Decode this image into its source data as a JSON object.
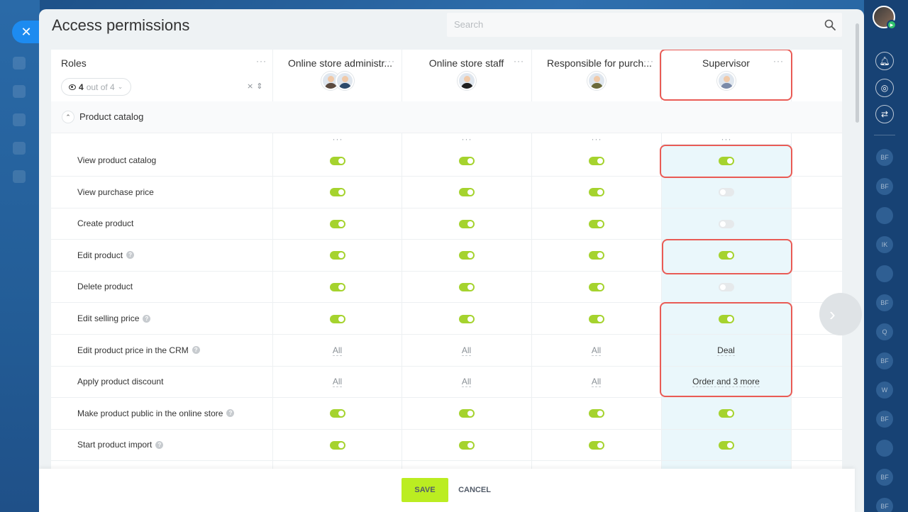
{
  "page": {
    "title": "Access permissions"
  },
  "search": {
    "placeholder": "Search",
    "value": ""
  },
  "roles_header": {
    "label": "Roles",
    "filter_visible": "4",
    "filter_suffix": "out of 4"
  },
  "roles": [
    {
      "name": "Online store administr...",
      "avatars": [
        "#5b4a3f",
        "#2d4a6b"
      ]
    },
    {
      "name": "Online store staff",
      "avatars": [
        "#1f1f1f"
      ]
    },
    {
      "name": "Responsible for purch...",
      "avatars": [
        "#6b6a3a"
      ]
    },
    {
      "name": "Supervisor",
      "avatars": [
        "#7a8aa8"
      ]
    }
  ],
  "section": {
    "title": "Product catalog"
  },
  "permissions": [
    {
      "label": "View product catalog",
      "help": false,
      "values": [
        "on",
        "on",
        "on",
        "on"
      ]
    },
    {
      "label": "View purchase price",
      "help": false,
      "values": [
        "on",
        "on",
        "on",
        "off"
      ]
    },
    {
      "label": "Create product",
      "help": false,
      "values": [
        "on",
        "on",
        "on",
        "off"
      ]
    },
    {
      "label": "Edit product",
      "help": true,
      "values": [
        "on",
        "on",
        "on",
        "on"
      ]
    },
    {
      "label": "Delete product",
      "help": false,
      "values": [
        "on",
        "on",
        "on",
        "off"
      ]
    },
    {
      "label": "Edit selling price",
      "help": true,
      "values": [
        "on",
        "on",
        "on",
        "on"
      ]
    },
    {
      "label": "Edit product price in the CRM",
      "help": true,
      "values": [
        "All",
        "All",
        "All",
        "Deal"
      ]
    },
    {
      "label": "Apply product discount",
      "help": false,
      "values": [
        "All",
        "All",
        "All",
        "Order and 3 more"
      ]
    },
    {
      "label": "Make product public in the online store",
      "help": true,
      "values": [
        "on",
        "on",
        "on",
        "on"
      ]
    },
    {
      "label": "Start product import",
      "help": true,
      "values": [
        "on",
        "on",
        "on",
        "on"
      ]
    }
  ],
  "footer": {
    "save_label": "SAVE",
    "cancel_label": "CANCEL"
  },
  "right_sidebar": {
    "users": [
      "BF",
      "BF",
      "",
      "IK",
      "",
      "BF",
      "Q",
      "BF",
      "W",
      "BF",
      "",
      "BF",
      "BF"
    ]
  },
  "colors": {
    "toggle_on": "#a5d32e",
    "toggle_off": "#e6e9eb",
    "highlight": "#e95b55",
    "save_button": "#bbed21",
    "supervisor_column_bg": "#eaf7fb"
  }
}
